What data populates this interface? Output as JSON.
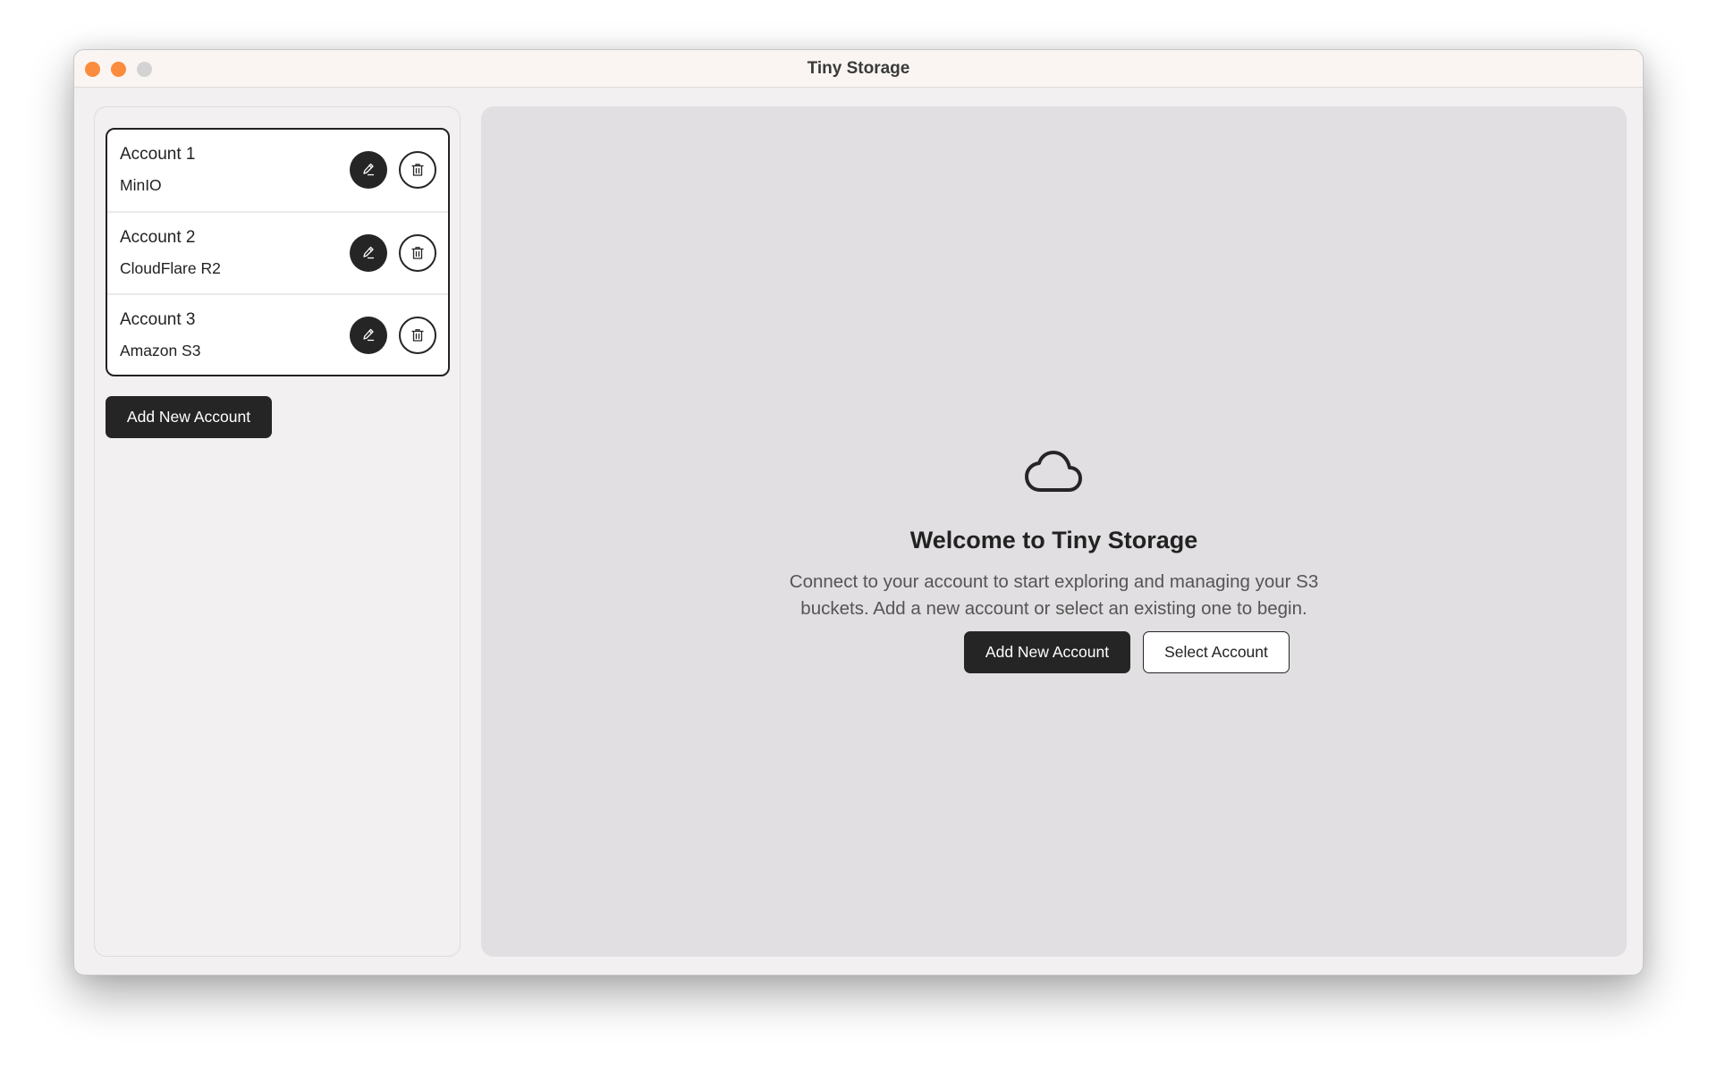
{
  "window": {
    "title": "Tiny Storage",
    "traffic_lights": [
      "close",
      "minimize",
      "maximize"
    ]
  },
  "sidebar": {
    "accounts": [
      {
        "name": "Account 1",
        "provider": "MinIO",
        "edit_icon": "pencil-icon",
        "delete_icon": "trash-icon"
      },
      {
        "name": "Account 2",
        "provider": "CloudFlare R2",
        "edit_icon": "pencil-icon",
        "delete_icon": "trash-icon"
      },
      {
        "name": "Account 3",
        "provider": "Amazon S3",
        "edit_icon": "pencil-icon",
        "delete_icon": "trash-icon"
      }
    ],
    "add_button_label": "Add New Account"
  },
  "main": {
    "icon": "cloud-icon",
    "title": "Welcome to Tiny Storage",
    "description": "Connect to your account to start exploring and managing your S3 buckets. Add a new account or select an existing one to begin.",
    "add_button_label": "Add New Account",
    "select_button_label": "Select Account"
  },
  "colors": {
    "accent_dark": "#252525",
    "traffic_close": "#fb8c3e",
    "traffic_min": "#fb8c3e",
    "traffic_max_disabled": "#d4d3d3",
    "main_background": "#e1dfe1",
    "sidebar_background": "#f2f0f1"
  }
}
